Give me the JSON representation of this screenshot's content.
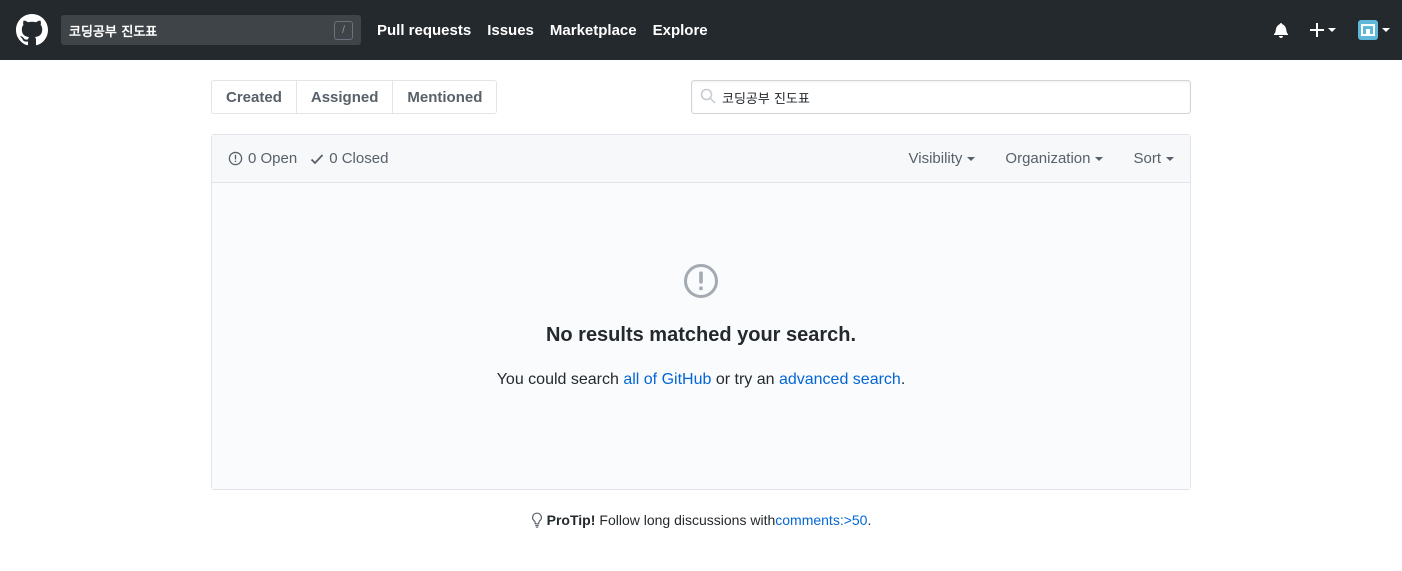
{
  "header": {
    "search_value": "코딩공부 진도표",
    "slash_key": "/",
    "nav": [
      "Pull requests",
      "Issues",
      "Marketplace",
      "Explore"
    ]
  },
  "subnav": {
    "tabs": [
      "Created",
      "Assigned",
      "Mentioned"
    ],
    "search_value": "코딩공부 진도표"
  },
  "box": {
    "open_label": "0 Open",
    "closed_label": "0 Closed",
    "filters": [
      "Visibility",
      "Organization",
      "Sort"
    ]
  },
  "blank": {
    "title": "No results matched your search.",
    "text_prefix": "You could search ",
    "link_all": "all of GitHub",
    "text_mid": " or try an ",
    "link_advanced": "advanced search",
    "text_suffix": "."
  },
  "protip": {
    "label": "ProTip!",
    "text": "Follow long discussions with ",
    "link": "comments:>50",
    "suffix": "."
  },
  "colors": {
    "header_bg": "#24292e",
    "link": "#0366d6",
    "muted": "#586069"
  },
  "icons": [
    "github-logo-icon",
    "bell-icon",
    "plus-icon",
    "avatar",
    "search-icon",
    "issue-open-icon",
    "check-icon",
    "alert-circle-icon",
    "light-bulb-icon"
  ]
}
